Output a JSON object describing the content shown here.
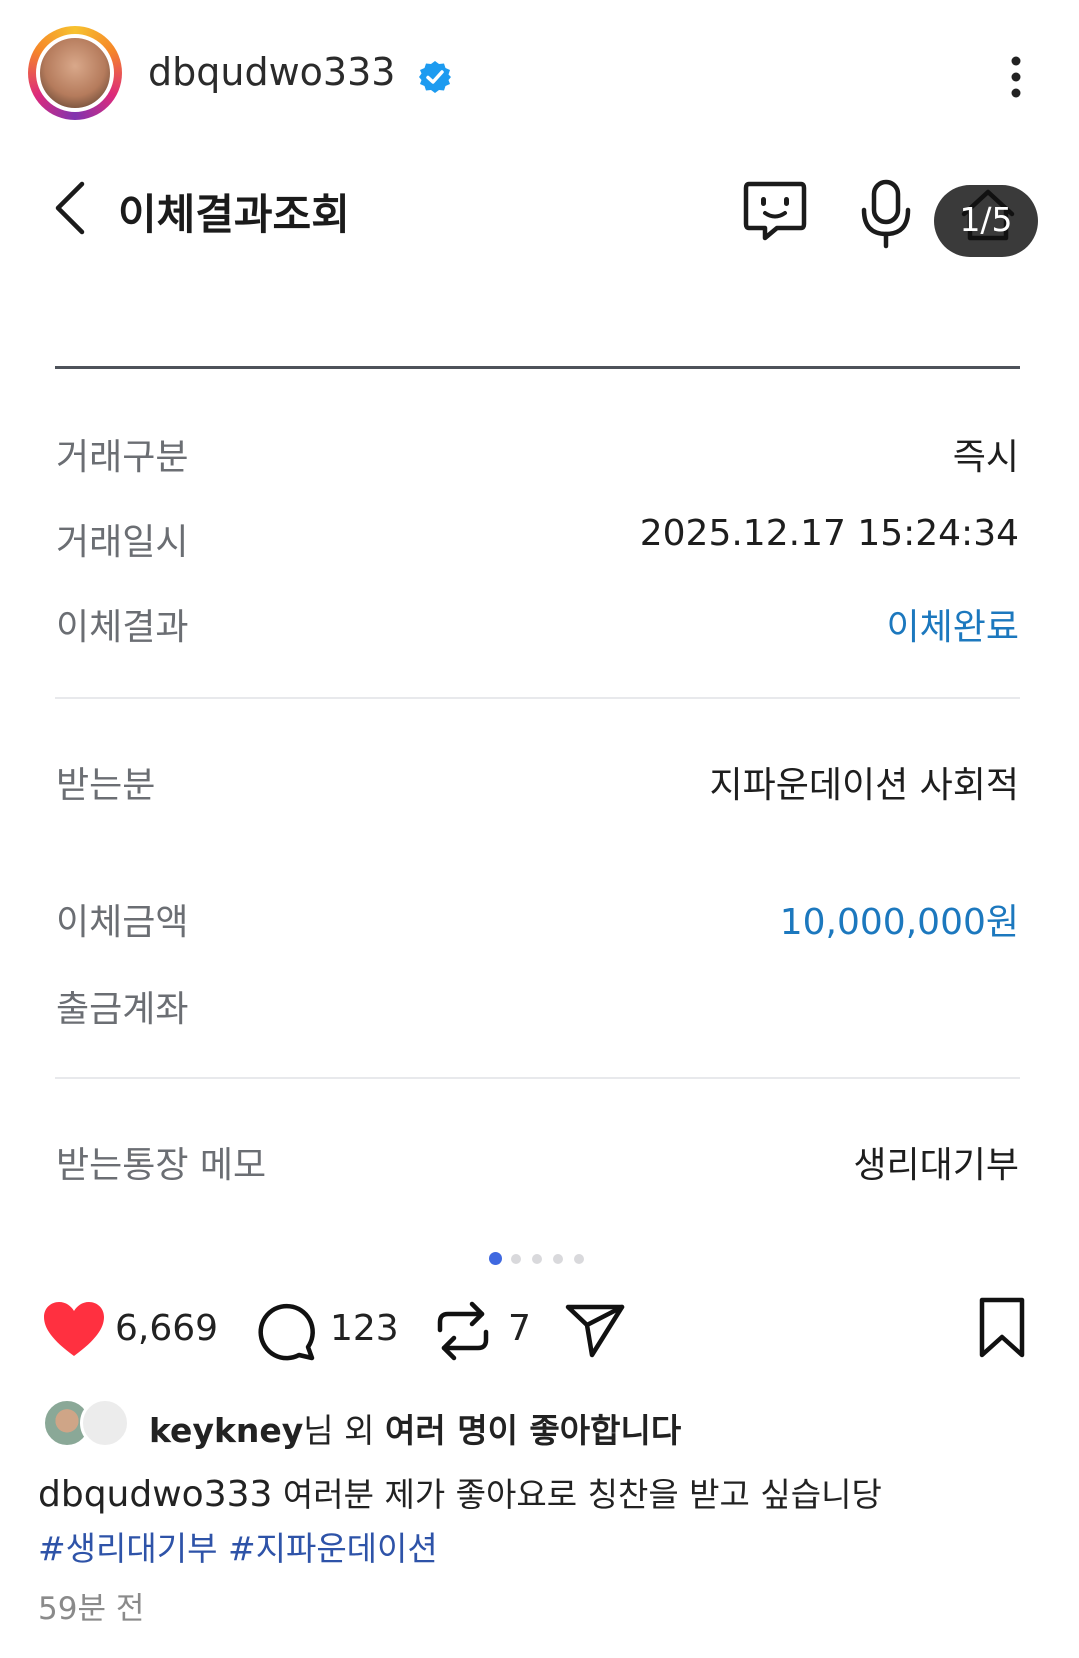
{
  "post": {
    "username": "dbqudwo333",
    "likes_count": "6,669",
    "comments_count": "123",
    "reposts_count": "7",
    "liked_by_name": "keykney",
    "liked_by_suffix": "님 외 ",
    "liked_by_rest": "여러 명이 좋아합니다",
    "caption_user": "dbqudwo333",
    "caption_text": "여러분 제가 좋아요로 칭찬을 받고 싶습니당",
    "hashtags": [
      "#생리대기부",
      "#지파운데이션"
    ],
    "time_ago": "59분 전",
    "carousel": {
      "current": 1,
      "total": 5
    }
  },
  "screenshot": {
    "title": "이체결과조회",
    "counter": "1/5",
    "rows": [
      {
        "label": "거래구분",
        "value": "즉시"
      },
      {
        "label": "거래일시",
        "value": "2025.12.17 15:24:34"
      },
      {
        "label": "이체결과",
        "value": "이체완료"
      },
      {
        "label": "받는분",
        "value": "지파운데이션 사회적"
      },
      {
        "label": "이체금액",
        "value": "10,000,000원"
      },
      {
        "label": "출금계좌",
        "value": ""
      },
      {
        "label": "받는통장 메모",
        "value": "생리대기부"
      }
    ]
  },
  "colors": {
    "accent_blue": "#1c78be",
    "heart_red": "#ff3040",
    "hashtag": "#2e53a8",
    "verified": "#1d9bf0"
  },
  "icons": [
    "more-icon",
    "back-icon",
    "chat-icon",
    "mic-icon",
    "home-icon",
    "heart-icon",
    "comment-icon",
    "repost-icon",
    "share-icon",
    "bookmark-icon",
    "verified-icon"
  ]
}
